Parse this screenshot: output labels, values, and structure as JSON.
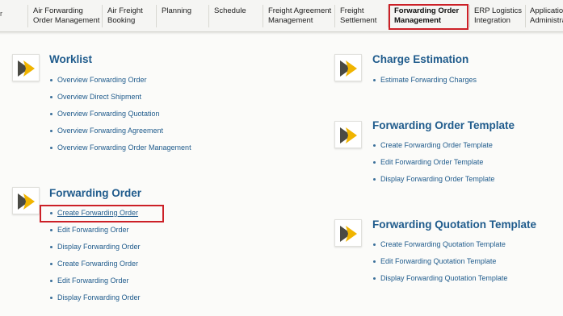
{
  "nav": {
    "edge_glyph": "r",
    "items": [
      {
        "line1": "Air Forwarding",
        "line2": "Order Management"
      },
      {
        "line1": "Air Freight",
        "line2": "Booking"
      },
      {
        "line1": "Planning",
        "line2": ""
      },
      {
        "line1": "Schedule",
        "line2": ""
      },
      {
        "line1": "Freight Agreement",
        "line2": "Management"
      },
      {
        "line1": "Freight",
        "line2": "Settlement"
      },
      {
        "line1": "Forwarding Order",
        "line2": "Management"
      },
      {
        "line1": "ERP Logistics",
        "line2": "Integration"
      },
      {
        "line1": "Application",
        "line2": "Administra"
      }
    ],
    "active_index": 6
  },
  "sections": {
    "worklist": {
      "title": "Worklist",
      "links": [
        "Overview Forwarding Order",
        "Overview Direct Shipment",
        "Overview Forwarding Quotation",
        "Overview Forwarding Agreement",
        "Overview Forwarding Order Management"
      ]
    },
    "forwarding_order": {
      "title": "Forwarding Order",
      "links": [
        "Create Forwarding Order",
        "Edit Forwarding Order",
        "Display Forwarding Order",
        "Create Forwarding Order",
        "Edit Forwarding Order",
        "Display Forwarding Order"
      ]
    },
    "charge_estimation": {
      "title": "Charge Estimation",
      "links": [
        "Estimate Forwarding Charges"
      ]
    },
    "forwarding_order_template": {
      "title": "Forwarding Order Template",
      "links": [
        "Create Forwarding Order Template",
        "Edit Forwarding Order Template",
        "Display Forwarding Order Template"
      ]
    },
    "forwarding_quotation_template": {
      "title": "Forwarding Quotation Template",
      "links": [
        "Create Forwarding Quotation Template",
        "Edit Forwarding Quotation Template",
        "Display Forwarding Quotation Template"
      ]
    }
  },
  "colors": {
    "link": "#1f5b8c",
    "title": "#1f5b8c",
    "highlight_box": "#cc2027",
    "icon_dark": "#4a4a44",
    "icon_yellow": "#f0b400"
  },
  "icons": {
    "section_tile": "launch-arrow-icon"
  }
}
